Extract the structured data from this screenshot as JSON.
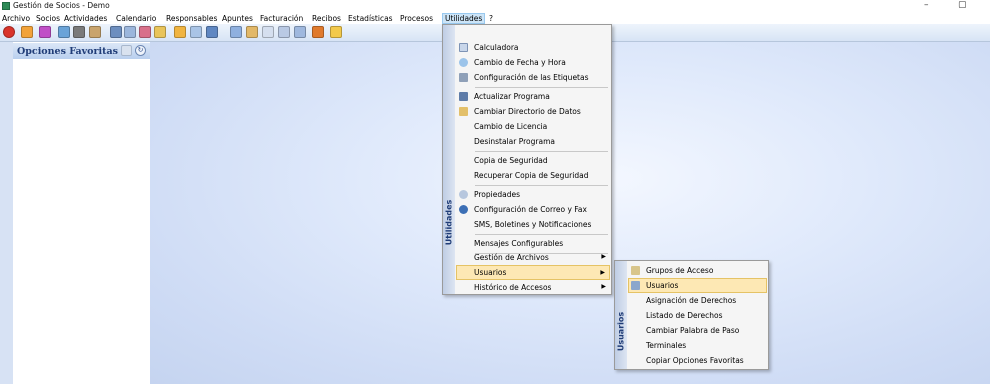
{
  "window": {
    "title": "Gestión de Socios - Demo",
    "minimize_glyph": "–",
    "maximize_glyph": "▢"
  },
  "menubar": [
    "Archivo",
    "Socios",
    "Actividades",
    "Calendario",
    "Responsables",
    "Apuntes",
    "Facturación",
    "Recibos",
    "Estadísticas",
    "Procesos",
    "Utilidades",
    "?"
  ],
  "active_menu": "Utilidades",
  "favorites": {
    "title": "Opciones Favoritas",
    "icons": [
      "settings-icon",
      "refresh-icon"
    ]
  },
  "toolbar": {
    "buttons": [
      "exit-icon",
      "open-icon",
      "undo-icon",
      "tools-icon",
      "save-icon",
      "user-icon",
      "card-icon",
      "calendar-icon",
      "table-icon",
      "chart-icon",
      "print-icon",
      "report-icon",
      "doc-icon",
      "mail-icon",
      "search-icon",
      "list-icon",
      "export-icon",
      "grid-icon",
      "bar-chart-icon",
      "folder-icon"
    ]
  },
  "utilidades_menu": {
    "sidebar_label": "Utilidades",
    "items": [
      {
        "label": "Calculadora",
        "icon": "calculator-icon"
      },
      {
        "label": "Cambio de Fecha y Hora",
        "icon": "clock-icon"
      },
      {
        "label": "Configuración de las Etiquetas",
        "icon": "label-icon"
      },
      {
        "label": "Actualizar Programa",
        "icon": "update-icon"
      },
      {
        "label": "Cambiar Directorio de Datos",
        "icon": "folder-icon"
      },
      {
        "label": "Cambio de Licencia",
        "icon": ""
      },
      {
        "label": "Desinstalar Programa",
        "icon": ""
      },
      {
        "label": "Copia de Seguridad",
        "icon": ""
      },
      {
        "label": "Recuperar Copia de Seguridad",
        "icon": ""
      },
      {
        "label": "Propiedades",
        "icon": "properties-icon"
      },
      {
        "label": "Configuración de Correo y Fax",
        "icon": "mail-icon"
      },
      {
        "label": "SMS, Boletines y Notificaciones",
        "icon": ""
      },
      {
        "label": "Mensajes Configurables",
        "icon": ""
      },
      {
        "label": "Gestión de Archivos",
        "icon": "",
        "submenu": true
      },
      {
        "label": "Usuarios",
        "icon": "",
        "submenu": true,
        "highlighted": true
      },
      {
        "label": "Histórico de Accesos",
        "icon": "",
        "submenu": true
      }
    ]
  },
  "usuarios_menu": {
    "sidebar_label": "Usuarios",
    "items": [
      {
        "label": "Grupos de Acceso",
        "icon": "group-icon"
      },
      {
        "label": "Usuarios",
        "icon": "users-icon",
        "highlighted": true
      },
      {
        "label": "Asignación de Derechos",
        "icon": ""
      },
      {
        "label": "Listado de Derechos",
        "icon": ""
      },
      {
        "label": "Cambiar Palabra de Paso",
        "icon": ""
      },
      {
        "label": "Terminales",
        "icon": ""
      },
      {
        "label": "Copiar Opciones Favoritas",
        "icon": ""
      }
    ]
  },
  "colors": {
    "menu_highlight": "#fde8b4",
    "menubar_active": "#cce4f7",
    "favorites_title": "#1f3c77",
    "desktop": "#dfe9fb"
  }
}
